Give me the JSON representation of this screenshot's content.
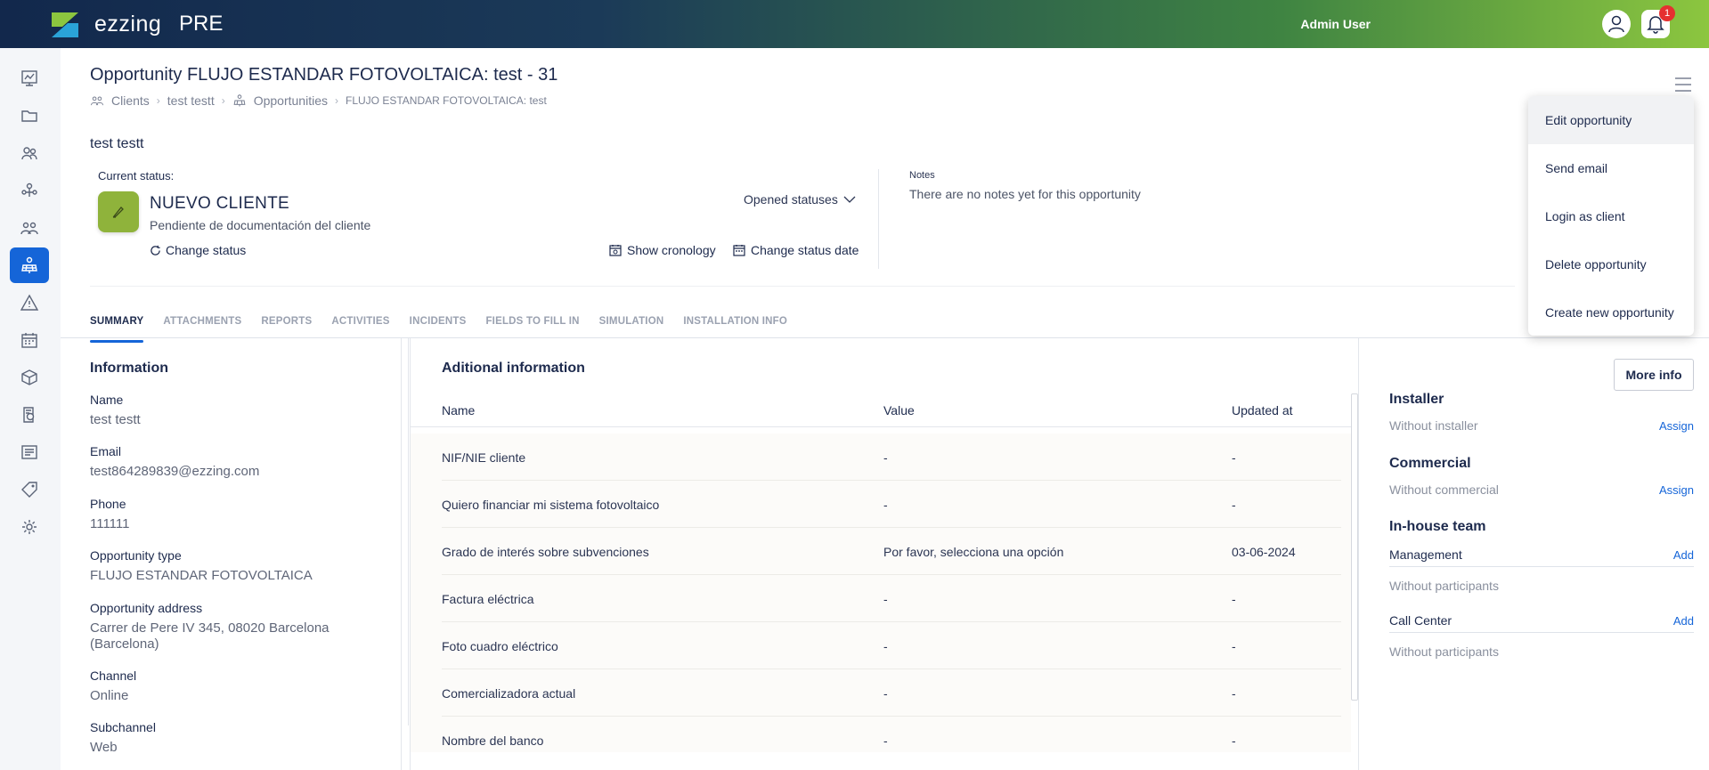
{
  "topbar": {
    "brand": "ezzing",
    "env": "PRE",
    "user": "Admin User",
    "notifications": "1"
  },
  "page": {
    "title": "Opportunity FLUJO ESTANDAR FOTOVOLTAICA: test - 31",
    "breadcrumb": [
      "Clients",
      "test testt",
      "Opportunities",
      "FLUJO ESTANDAR FOTOVOLTAICA: test"
    ],
    "client_name": "test testt"
  },
  "status": {
    "label": "Current status:",
    "name": "NUEVO CLIENTE",
    "description": "Pendiente de documentación del cliente",
    "change_status": "Change status",
    "opened_statuses": "Opened statuses",
    "show_cronology": "Show cronology",
    "change_status_date": "Change status date",
    "color": "#8fb33b"
  },
  "notes": {
    "label": "Notes",
    "text": "There are no notes yet for this opportunity"
  },
  "tabs": [
    "SUMMARY",
    "ATTACHMENTS",
    "REPORTS",
    "ACTIVITIES",
    "INCIDENTS",
    "FIELDS TO FILL IN",
    "SIMULATION",
    "INSTALLATION INFO"
  ],
  "information": {
    "title": "Information",
    "fields": [
      {
        "label": "Name",
        "value": "test testt"
      },
      {
        "label": "Email",
        "value": "test864289839@ezzing.com"
      },
      {
        "label": "Phone",
        "value": "111111"
      },
      {
        "label": "Opportunity type",
        "value": "FLUJO ESTANDAR FOTOVOLTAICA"
      },
      {
        "label": "Opportunity address",
        "value": "Carrer de Pere IV 345, 08020 Barcelona (Barcelona)"
      },
      {
        "label": "Channel",
        "value": "Online"
      },
      {
        "label": "Subchannel",
        "value": "Web"
      }
    ]
  },
  "additional": {
    "title": "Aditional information",
    "columns": [
      "Name",
      "Value",
      "Updated at"
    ],
    "rows": [
      {
        "name": "NIF/NIE cliente",
        "value": "-",
        "updated": "-"
      },
      {
        "name": "Quiero financiar mi sistema fotovoltaico",
        "value": "-",
        "updated": "-"
      },
      {
        "name": "Grado de interés sobre subvenciones",
        "value": "Por favor, selecciona una opción",
        "updated": "03-06-2024"
      },
      {
        "name": "Factura eléctrica",
        "value": "-",
        "updated": "-"
      },
      {
        "name": "Foto cuadro eléctrico",
        "value": "-",
        "updated": "-"
      },
      {
        "name": "Comercializadora actual",
        "value": "-",
        "updated": "-"
      },
      {
        "name": "Nombre del banco",
        "value": "-",
        "updated": "-"
      }
    ]
  },
  "right": {
    "more_info": "More info",
    "installer": {
      "title": "Installer",
      "text": "Without installer",
      "action": "Assign"
    },
    "commercial": {
      "title": "Commercial",
      "text": "Without commercial",
      "action": "Assign"
    },
    "inhouse": {
      "title": "In-house team",
      "teams": [
        {
          "name": "Management",
          "action": "Add",
          "text": "Without participants"
        },
        {
          "name": "Call Center",
          "action": "Add",
          "text": "Without participants"
        }
      ]
    }
  },
  "dropdown": [
    "Edit opportunity",
    "Send email",
    "Login as client",
    "Delete opportunity",
    "Create new opportunity"
  ],
  "colors": {
    "accent": "#1565d8",
    "sidebar_active": "#1565d8"
  }
}
